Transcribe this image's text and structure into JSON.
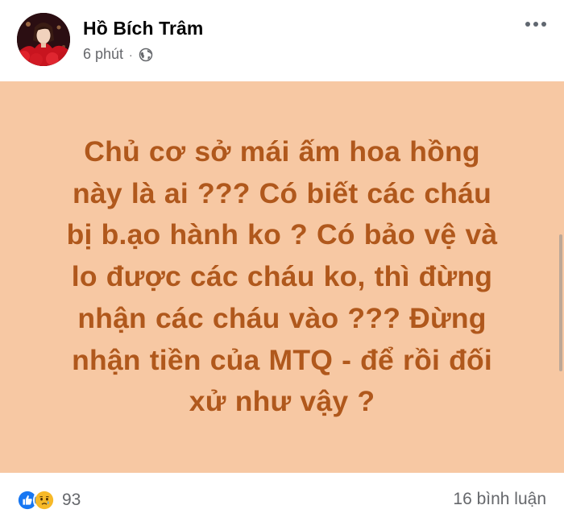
{
  "post": {
    "author": "Hồ Bích Trâm",
    "time": "6 phút",
    "separator": "·",
    "privacy_icon": "globe-icon",
    "body_lines": [
      "Chủ cơ sở mái ấm hoa hồng",
      "này là ai ??? Có biết các cháu",
      "bị b.ạo hành ko ? Có bảo vệ và",
      "lo được các cháu ko, thì đừng",
      "nhận các cháu vào ??? Đừng",
      "nhận tiền của MTQ - để rồi đối",
      "xử như vậy ?"
    ],
    "reactions": {
      "icons": [
        "like-icon",
        "sad-icon"
      ],
      "count": "93"
    },
    "comments_label": "16 bình luận"
  },
  "colors": {
    "banner_background": "#f7c8a3",
    "banner_text": "#b0581c",
    "like": "#1877f2",
    "sad": "#f7b928",
    "secondary_text": "#65676b"
  }
}
